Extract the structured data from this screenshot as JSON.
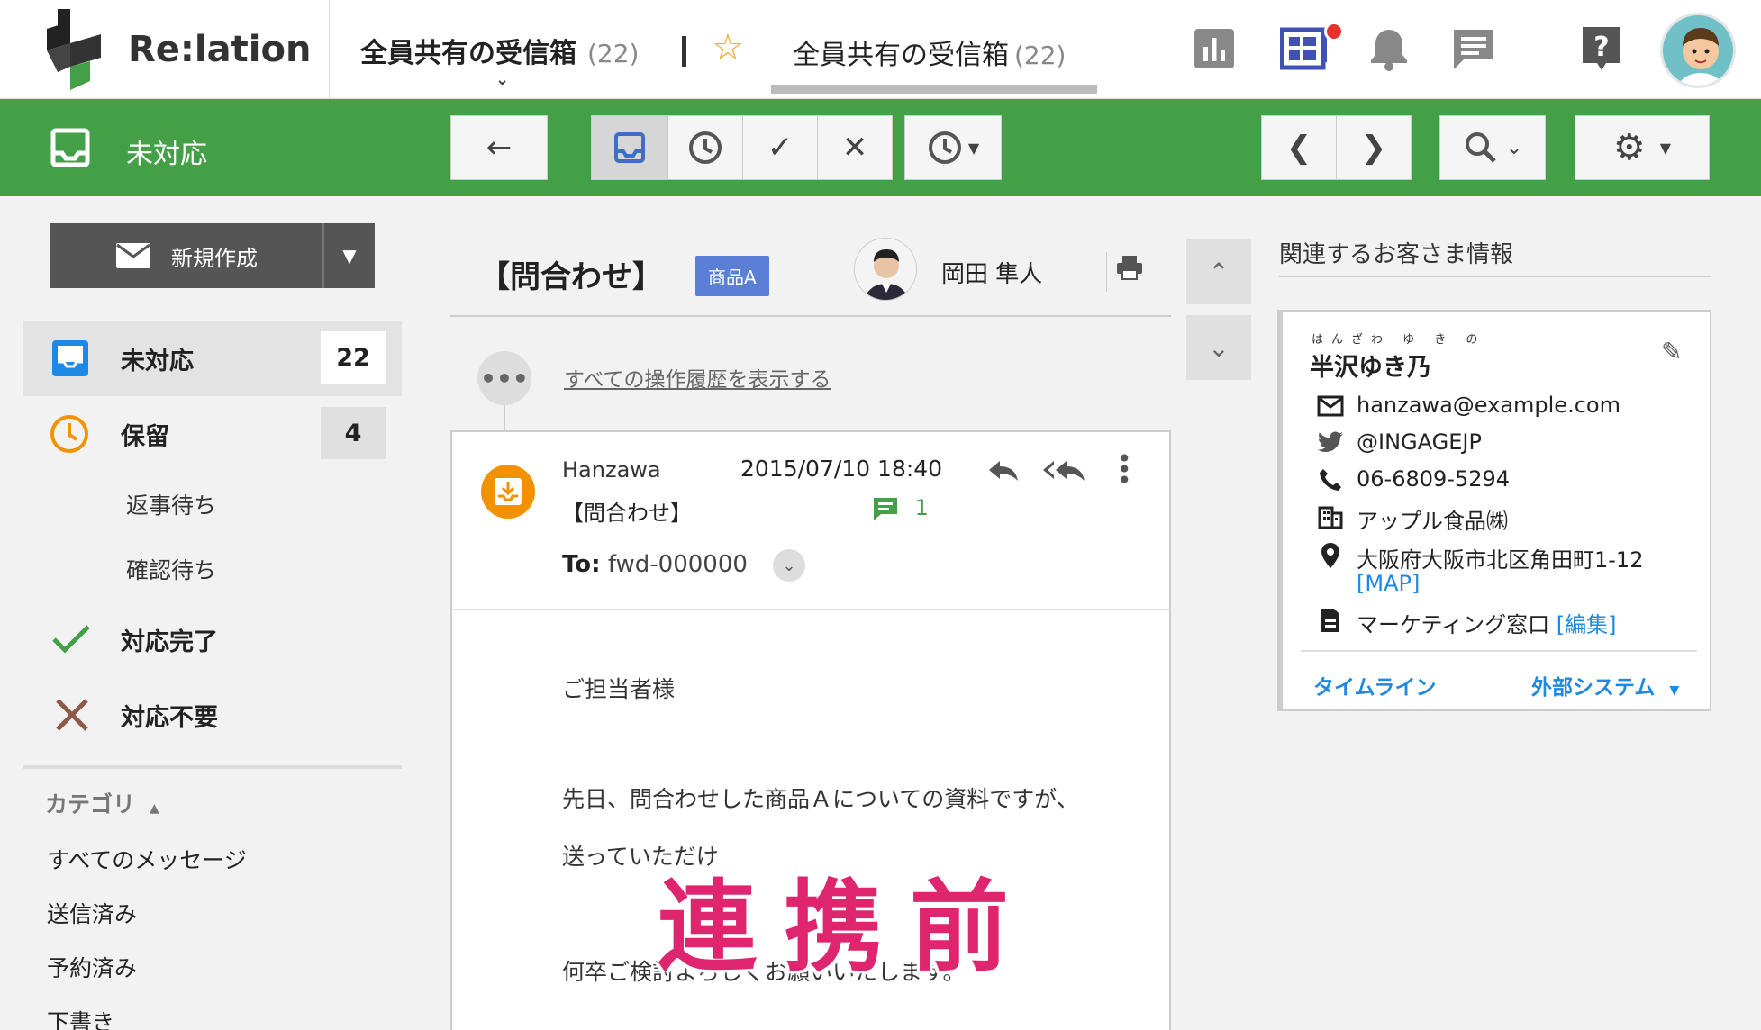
{
  "app": {
    "name": "Re:lation"
  },
  "header": {
    "inbox_selector": "全員共有の受信箱",
    "inbox_selector_count": "(22)",
    "inbox_tab": "全員共有の受信箱",
    "inbox_tab_count": "(22)",
    "icons": [
      "bar-chart-icon",
      "dashboard-icon",
      "bell-icon",
      "chat-icon",
      "help-icon",
      "user-avatar"
    ]
  },
  "toolbar": {
    "title": "未対応"
  },
  "sidebar": {
    "compose_label": "新規作成",
    "status_items": [
      {
        "label": "未対応",
        "count": "22"
      },
      {
        "label": "保留",
        "count": "4"
      },
      {
        "label": "返事待ち"
      },
      {
        "label": "確認待ち"
      },
      {
        "label": "対応完了"
      },
      {
        "label": "対応不要"
      }
    ],
    "category_label": "カテゴリ",
    "links": [
      "すべてのメッセージ",
      "送信済み",
      "予約済み",
      "下書き"
    ]
  },
  "ticket": {
    "subject": "【問合わせ】",
    "tag": "商品A",
    "assignee": "岡田 隼人",
    "history_link": "すべての操作履歴を表示する",
    "message": {
      "from": "Hanzawa",
      "date": "2015/07/10 18:40",
      "subject": "【問合わせ】",
      "comment_count": "1",
      "to_label": "To:",
      "to_value": "fwd-000000",
      "body": [
        "ご担当者様",
        "先日、問合わせした商品Ａについての資料ですが、",
        "送っていただけ",
        "何卒ご検討よろしくお願いいたします。"
      ]
    }
  },
  "overlay_text": "連携前",
  "customer": {
    "section_title": "関連するお客さま情報",
    "ruby": "はんざわ ゆ き の",
    "name": "半沢ゆき乃",
    "email": "hanzawa@example.com",
    "twitter": "@INGAGEJP",
    "phone": "06-6809-5294",
    "company": "アップル食品㈱",
    "address": "大阪府大阪市北区角田町1-12",
    "map_link": "[MAP]",
    "note": "マーケティング窓口",
    "edit_link": "[編集]",
    "tab_timeline": "タイムライン",
    "tab_external": "外部システム"
  },
  "colors": {
    "green": "#43a047",
    "orange": "#f39200",
    "blue": "#1e88e5",
    "tag": "#5b7fd4",
    "overlay": "#e0256f"
  }
}
